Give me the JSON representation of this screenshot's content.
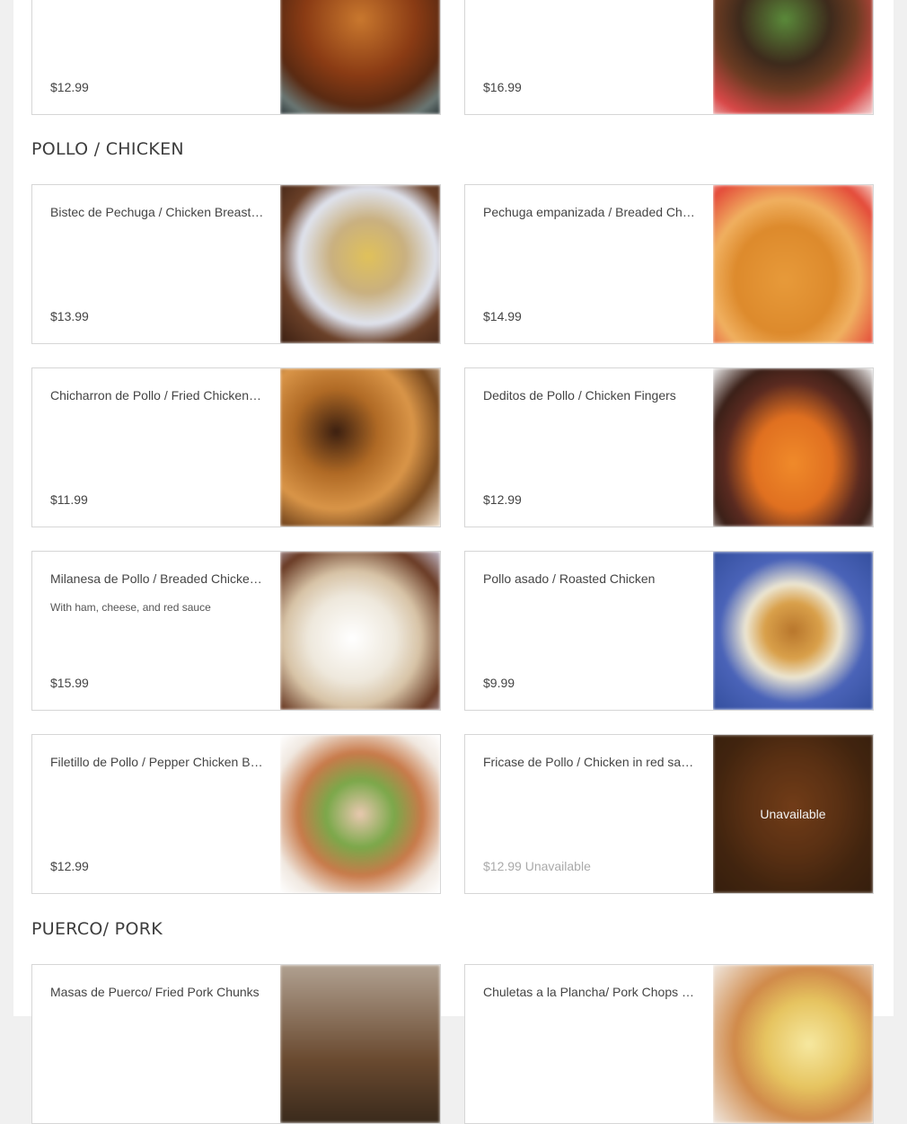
{
  "sections": {
    "chicken": {
      "title": "POLLO / CHICKEN"
    },
    "pork": {
      "title": "PUERCO/ PORK"
    }
  },
  "top_items": [
    {
      "price": "$12.99",
      "photo": "stew-photo"
    },
    {
      "price": "$16.99",
      "photo": "steak-photo"
    }
  ],
  "chicken_items": [
    {
      "name": "Bistec de Pechuga / Chicken Breast Steak",
      "price": "$13.99"
    },
    {
      "name": "Pechuga empanizada / Breaded Chicken Breast",
      "price": "$14.99"
    },
    {
      "name": "Chicharron de Pollo / Fried Chicken Chunks",
      "price": "$11.99"
    },
    {
      "name": "Deditos de Pollo / Chicken Fingers",
      "price": "$12.99"
    },
    {
      "name": "Milanesa de Pollo / Breaded Chicken Milanesa",
      "description": "With ham, cheese, and red sauce",
      "price": "$15.99"
    },
    {
      "name": "Pollo asado / Roasted Chicken",
      "price": "$9.99"
    },
    {
      "name": "Filetillo de Pollo / Pepper Chicken Breast",
      "price": "$12.99"
    },
    {
      "name": "Fricase de Pollo / Chicken in red sauce",
      "price": "$12.99 Unavailable",
      "overlay": "Unavailable"
    }
  ],
  "pork_items": [
    {
      "name": "Masas de Puerco/ Fried Pork Chunks"
    },
    {
      "name": "Chuletas a la Plancha/ Pork Chops on the grill"
    }
  ]
}
